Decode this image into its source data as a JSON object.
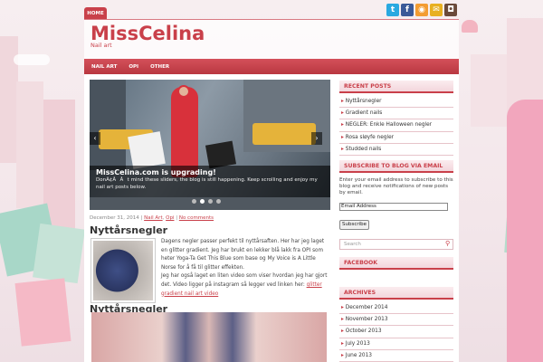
{
  "header": {
    "home_tab": "HOME",
    "site_title": "MissCelina",
    "tagline": "Nail art",
    "social": [
      {
        "icon": "twitter-icon",
        "glyph": "t",
        "color": "#2aa9e0"
      },
      {
        "icon": "facebook-icon",
        "glyph": "f",
        "color": "#3b5998"
      },
      {
        "icon": "rss-icon",
        "glyph": "◉",
        "color": "#f39c32"
      },
      {
        "icon": "mail-icon",
        "glyph": "✉",
        "color": "#e8b020"
      },
      {
        "icon": "camera-icon",
        "glyph": "◘",
        "color": "#6b4a3a"
      }
    ]
  },
  "nav": {
    "items": [
      "NAIL ART",
      "OPI",
      "OTHER"
    ]
  },
  "slider": {
    "title": "MissCelina.com is upgrading!",
    "description": "DonÃ¢ÂÂt mind these sliders, the blog is still happening. Keep scrolling and enjoy my nail art posts below.",
    "prev_glyph": "‹",
    "next_glyph": "›",
    "slide_count": 4,
    "active_slide": 1
  },
  "post": {
    "date": "December 31, 2014",
    "sep1": " | ",
    "categories": [
      "Nail Art",
      "Opi"
    ],
    "cat_sep": ", ",
    "sep2": " | ",
    "comments": "No comments",
    "title": "Nyttårsnegler",
    "body_1": "Dagens negler passer perfekt til nyttårsaften. Her har jeg laget en glitter gradient. Jeg har brukt en lekker blå lakk fra OPI som heter Yoga-Ta Get This Blue som base og My Voice is A Little Norse for å få til glitter effekten.",
    "body_2": "Jeg har også laget en liten video som viser hvordan jeg har gjort det. Video ligger på instagram så legger ved linken her: ",
    "link": "glitter gradient nail art video"
  },
  "post2": {
    "title": "Nyttårsnegler"
  },
  "sidebar": {
    "recent_heading": "RECENT POSTS",
    "recent": [
      "Nyttårsnegler",
      "Gradient nails",
      "NEGLER: Enkle Halloween negler",
      "Rosa sløyfe negler",
      "Studded nails"
    ],
    "subscribe_heading": "SUBSCRIBE TO BLOG VIA EMAIL",
    "subscribe_text": "Enter your email address to subscribe to this blog and receive notifications of new posts by email.",
    "email_value": "Email Address",
    "subscribe_button": "Subscribe",
    "search_placeholder": "Search",
    "facebook_heading": "FACEBOOK",
    "archives_heading": "ARCHIVES",
    "archives": [
      "December 2014",
      "November 2013",
      "October 2013",
      "July 2013",
      "June 2013"
    ]
  },
  "colors": {
    "accent": "#c9404a"
  }
}
